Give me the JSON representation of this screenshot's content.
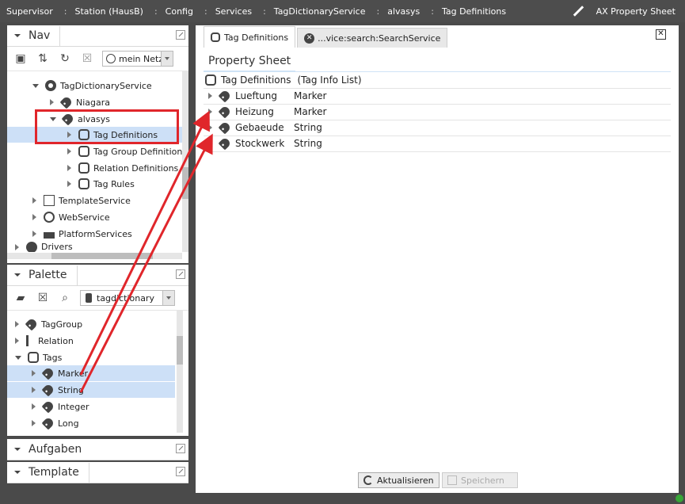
{
  "breadcrumb": [
    "Supervisor",
    "Station (HausB)",
    "Config",
    "Services",
    "TagDictionaryService",
    "alvasys",
    "Tag Definitions"
  ],
  "view_selector": "AX Property Sheet",
  "nav": {
    "title": "Nav",
    "host_combo": "mein Netzw",
    "tree": [
      {
        "label": "TagDictionaryService",
        "icon": "gear-icon",
        "expanded": true
      },
      {
        "label": "Niagara",
        "icon": "tag-icon",
        "expanded": false
      },
      {
        "label": "alvasys",
        "icon": "tag-icon",
        "expanded": true
      },
      {
        "label": "Tag Definitions",
        "icon": "tag-info-list-icon",
        "selected": true
      },
      {
        "label": "Tag Group Definitions",
        "icon": "tag-info-list-icon"
      },
      {
        "label": "Relation Definitions",
        "icon": "tag-info-list-icon"
      },
      {
        "label": "Tag Rules",
        "icon": "tag-info-list-icon"
      },
      {
        "label": "TemplateService",
        "icon": "template-service-icon"
      },
      {
        "label": "WebService",
        "icon": "globe-icon"
      },
      {
        "label": "PlatformServices",
        "icon": "platform-services-icon"
      },
      {
        "label": "Drivers",
        "icon": "drivers-icon"
      }
    ]
  },
  "palette": {
    "title": "Palette",
    "module_combo": "tagdictionary",
    "tree": [
      {
        "label": "TagGroup",
        "icon": "tag-icon"
      },
      {
        "label": "Relation",
        "icon": "relation-icon"
      },
      {
        "label": "Tags",
        "icon": "tag-info-list-icon",
        "expanded": true
      },
      {
        "label": "Marker",
        "icon": "tag-icon",
        "selected": true
      },
      {
        "label": "String",
        "icon": "tag-icon",
        "selected": true
      },
      {
        "label": "Integer",
        "icon": "tag-icon"
      },
      {
        "label": "Long",
        "icon": "tag-icon"
      }
    ]
  },
  "sidebar_tabs": {
    "aufgaben": "Aufgaben",
    "template": "Template"
  },
  "tabs": [
    {
      "label": "Tag Definitions",
      "active": true
    },
    {
      "label": "...vice:search:SearchService",
      "active": false
    }
  ],
  "view_title": "Property Sheet",
  "root": {
    "name": "Tag Definitions",
    "type": "(Tag Info List)"
  },
  "properties": [
    {
      "name": "Lueftung",
      "value": "Marker"
    },
    {
      "name": "Heizung",
      "value": "Marker"
    },
    {
      "name": "Gebaeude",
      "value": "String"
    },
    {
      "name": "Stockwerk",
      "value": "String"
    }
  ],
  "buttons": {
    "refresh": "Aktualisieren",
    "save": "Speichern"
  },
  "colors": {
    "selection": "#cde0f7",
    "annotation": "#e0262b",
    "accent": "#cfe3f6"
  }
}
